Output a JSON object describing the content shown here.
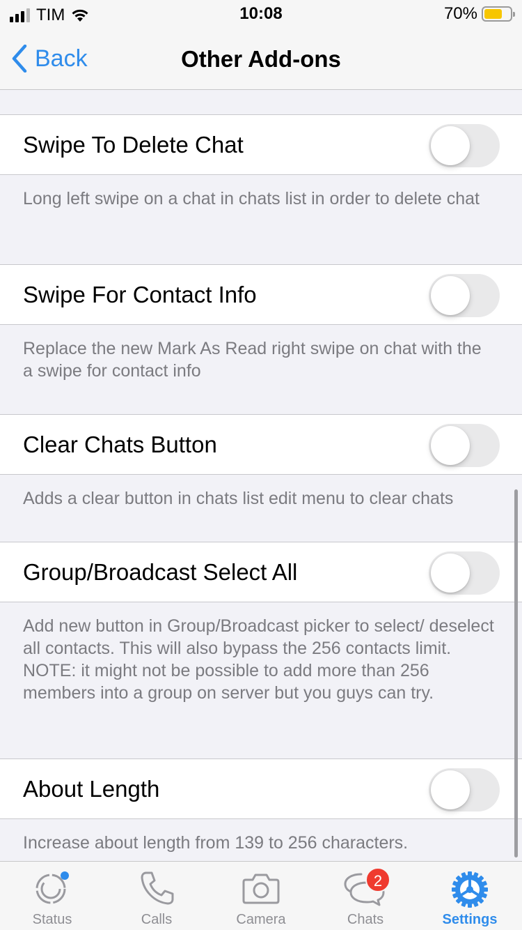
{
  "status_bar": {
    "carrier": "TIM",
    "time": "10:08",
    "battery_percent": "70%",
    "battery_level": 0.7,
    "battery_color": "#f7c600"
  },
  "nav": {
    "back_label": "Back",
    "title": "Other Add-ons",
    "accent_color": "#2f8ceb"
  },
  "settings": [
    {
      "label": "Swipe To Delete Chat",
      "enabled": false,
      "description": "Long left swipe on a chat in chats list in order to delete chat"
    },
    {
      "label": "Swipe For Contact Info",
      "enabled": false,
      "description": "Replace the new Mark As Read right swipe on chat with the a swipe for contact info"
    },
    {
      "label": "Clear Chats Button",
      "enabled": false,
      "description": "Adds a clear button in chats list edit menu to clear chats"
    },
    {
      "label": "Group/Broadcast Select All",
      "enabled": false,
      "description": "Add new button in Group/Broadcast picker to select/ deselect all contacts. This will also bypass the 256 contacts limit. NOTE: it might not be possible to add more than 256 members into a group on server but you guys can try."
    },
    {
      "label": "About Length",
      "enabled": false,
      "description": "Increase about length from 139 to 256 characters."
    }
  ],
  "tab_bar": {
    "tabs": [
      {
        "label": "Status",
        "icon": "status-icon"
      },
      {
        "label": "Calls",
        "icon": "phone-icon"
      },
      {
        "label": "Camera",
        "icon": "camera-icon"
      },
      {
        "label": "Chats",
        "icon": "chat-bubbles-icon",
        "badge": "2"
      },
      {
        "label": "Settings",
        "icon": "gear-icon",
        "active": true
      }
    ],
    "active_color": "#2f8ceb",
    "badge_color": "#ef3a2f"
  }
}
